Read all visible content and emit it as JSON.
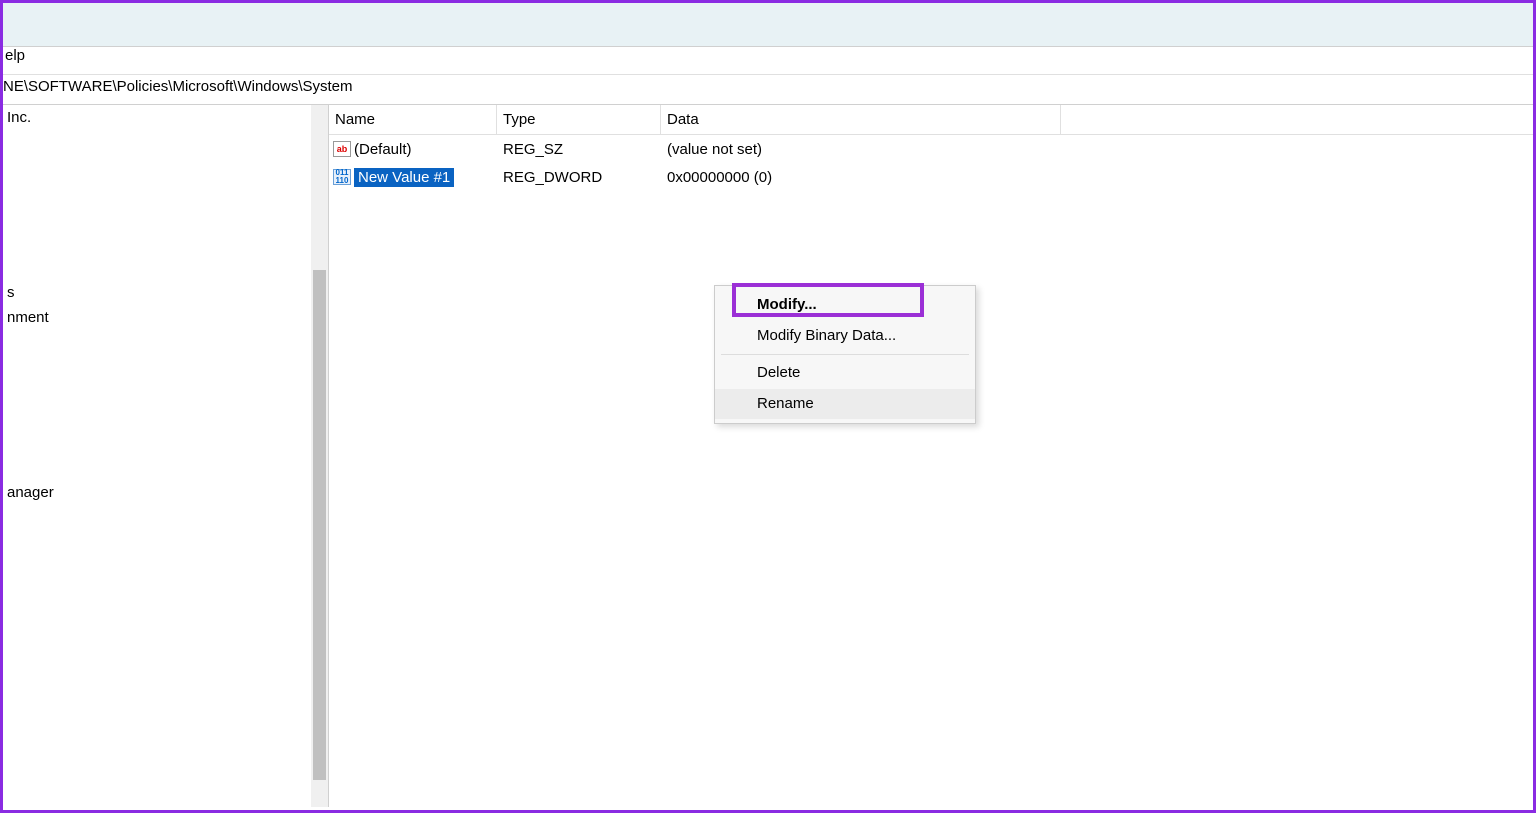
{
  "menubar": {
    "help": "elp"
  },
  "addressbar": {
    "path": "NE\\SOFTWARE\\Policies\\Microsoft\\Windows\\System"
  },
  "tree": {
    "items": [
      "Inc.",
      "s",
      "nment",
      "anager"
    ]
  },
  "columns": {
    "name": "Name",
    "type": "Type",
    "data": "Data"
  },
  "values": [
    {
      "name": "(Default)",
      "type": "REG_SZ",
      "data": "(value not set)",
      "icon": "ab"
    },
    {
      "name": "New Value #1",
      "type": "REG_DWORD",
      "data": "0x00000000 (0)",
      "icon": "dw",
      "selected": true
    }
  ],
  "context_menu": {
    "modify": "Modify...",
    "modify_binary": "Modify Binary Data...",
    "delete": "Delete",
    "rename": "Rename"
  }
}
